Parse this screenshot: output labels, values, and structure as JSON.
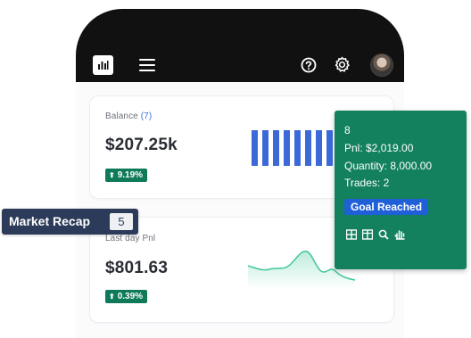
{
  "header": {
    "logo_icon": "chart-logo-icon",
    "menu_icon": "hamburger-menu-icon",
    "help_icon": "help-circle-icon",
    "settings_icon": "gear-icon",
    "avatar": "user-avatar"
  },
  "balance_card": {
    "label": "Balance",
    "count": "(7)",
    "value": "$207.25k",
    "change": "9.19%",
    "change_icon": "arrow-up-icon",
    "accent_color": "#0f7a5a",
    "bar_color": "#3b6ad8"
  },
  "pnl_card": {
    "label": "Last day Pnl",
    "value": "$801.63",
    "change": "0.39%",
    "change_icon": "arrow-up-icon",
    "line_color": "#3fc79a"
  },
  "tooltip": {
    "title": "8",
    "pnl": "Pnl: $2,019.00",
    "quantity": "Quantity: 8,000.00",
    "trades": "Trades: 2",
    "goal": "Goal Reached",
    "icons": [
      "table-icon",
      "grid-icon",
      "zoom-icon",
      "hand-icon"
    ],
    "background": "#13805e",
    "goal_color": "#1f5fd8"
  },
  "market_recap": {
    "label": "Market Recap",
    "count": "5"
  }
}
